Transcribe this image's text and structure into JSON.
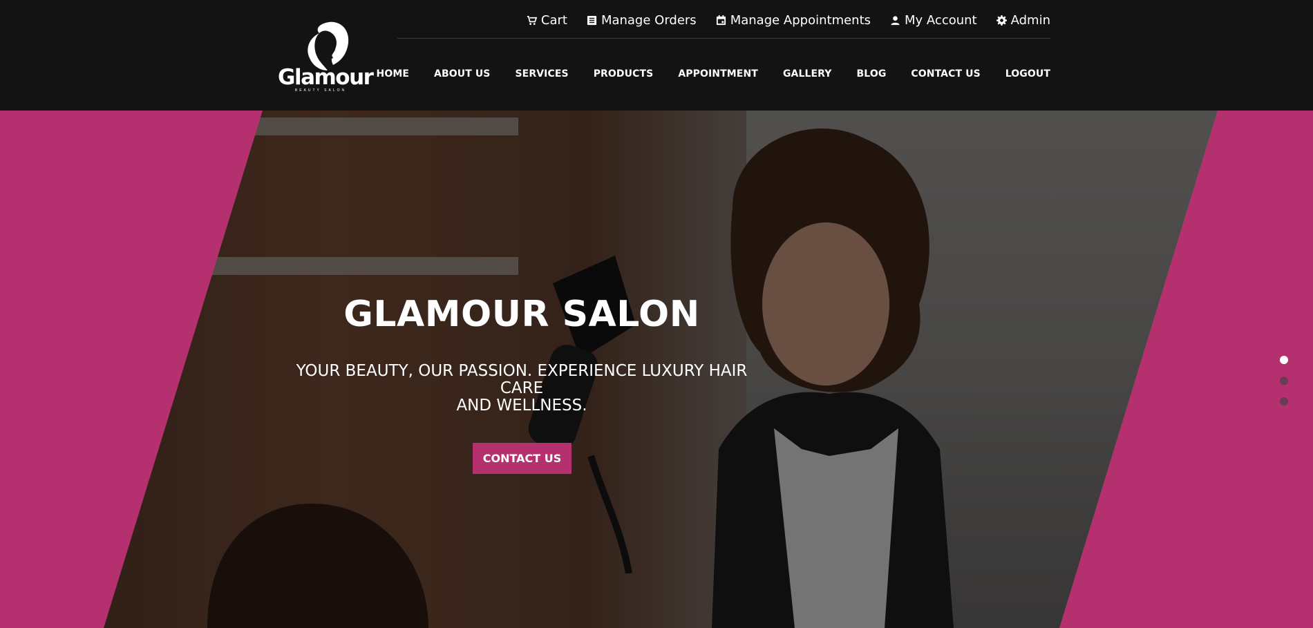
{
  "brand": {
    "name": "Glamour",
    "tagline": "BEAUTY SALON"
  },
  "utility_nav": [
    {
      "label": "Cart",
      "icon": "cart-icon"
    },
    {
      "label": "Manage Orders",
      "icon": "list-icon"
    },
    {
      "label": "Manage Appointments",
      "icon": "calendar-icon"
    },
    {
      "label": "My Account",
      "icon": "user-icon"
    },
    {
      "label": "Admin",
      "icon": "gear-icon"
    }
  ],
  "main_nav": [
    {
      "label": "HOME"
    },
    {
      "label": "ABOUT US"
    },
    {
      "label": "SERVICES"
    },
    {
      "label": "PRODUCTS"
    },
    {
      "label": "APPOINTMENT"
    },
    {
      "label": "GALLERY"
    },
    {
      "label": "BLOG"
    },
    {
      "label": "CONTACT US"
    },
    {
      "label": "LOGOUT"
    }
  ],
  "hero": {
    "title": "GLAMOUR SALON",
    "subtitle_line1": "YOUR BEAUTY, OUR PASSION. EXPERIENCE LUXURY HAIR CARE",
    "subtitle_line2": "AND WELLNESS.",
    "cta_label": "CONTACT US"
  },
  "carousel": {
    "slides": 3,
    "active_index": 0
  },
  "colors": {
    "header_bg": "#131313",
    "accent": "#b5306e",
    "text": "#ffffff"
  }
}
